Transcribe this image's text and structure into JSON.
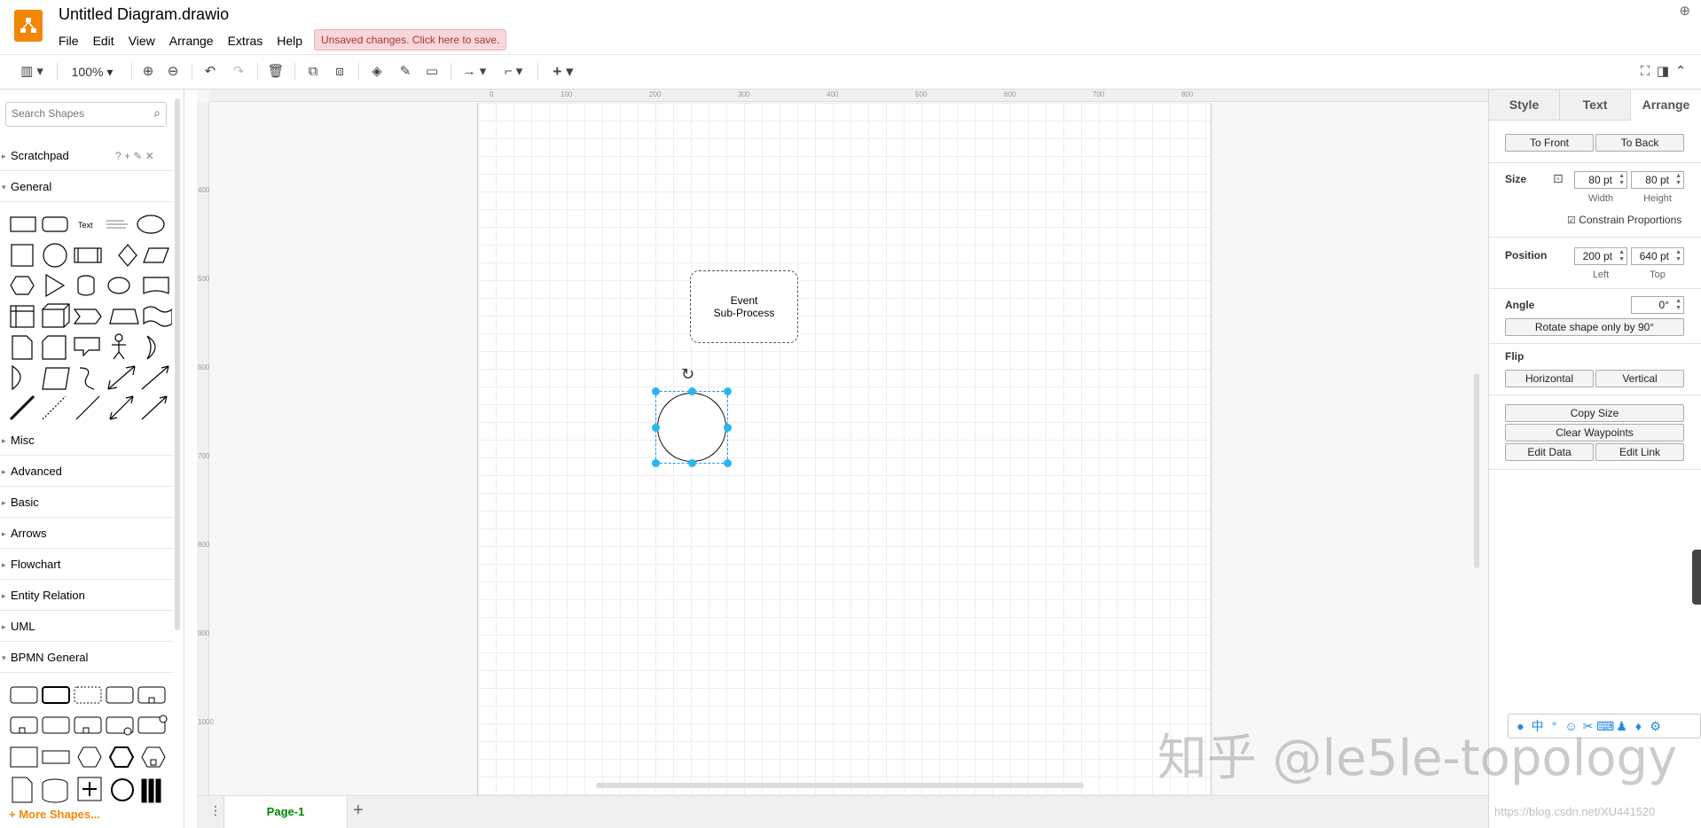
{
  "app": {
    "title": "Untitled Diagram.drawio",
    "menu": [
      "File",
      "Edit",
      "View",
      "Arrange",
      "Extras",
      "Help"
    ],
    "unsaved_notice": "Unsaved changes. Click here to save."
  },
  "toolbar": {
    "zoom": "100%"
  },
  "sidebar": {
    "search_placeholder": "Search Shapes",
    "scratchpad_tools": "? + ✎ ✕",
    "sections": [
      "Scratchpad",
      "General",
      "Misc",
      "Advanced",
      "Basic",
      "Arrows",
      "Flowchart",
      "Entity Relation",
      "UML",
      "BPMN General"
    ],
    "general_text_shape": "Text",
    "more_shapes": "More Shapes..."
  },
  "ruler": {
    "top": [
      "0",
      "100",
      "200",
      "300",
      "400",
      "500",
      "600",
      "700",
      "800"
    ],
    "left": [
      "400",
      "500",
      "600",
      "700",
      "800",
      "900",
      "1000"
    ]
  },
  "diagram": {
    "sub_process_label": "Event\nSub-Process"
  },
  "pages": {
    "tabs": [
      "Page-1"
    ]
  },
  "format_panel": {
    "tabs": [
      "Style",
      "Text",
      "Arrange"
    ],
    "active_tab": "Arrange",
    "to_front": "To Front",
    "to_back": "To Back",
    "size_label": "Size",
    "width_value": "80 pt",
    "height_value": "80 pt",
    "width_label": "Width",
    "height_label": "Height",
    "constrain": "Constrain Proportions",
    "position_label": "Position",
    "left_value": "200 pt",
    "top_value": "640 pt",
    "left_label": "Left",
    "top_label": "Top",
    "angle_label": "Angle",
    "angle_value": "0°",
    "rotate_btn": "Rotate shape only by 90°",
    "flip_label": "Flip",
    "flip_horizontal": "Horizontal",
    "flip_vertical": "Vertical",
    "copy_size": "Copy Size",
    "clear_waypoints": "Clear Waypoints",
    "edit_data": "Edit Data",
    "edit_link": "Edit Link"
  },
  "ime": {
    "lang": "中"
  },
  "watermark": {
    "main": "知乎 @le5le-topology",
    "url": "https://blog.csdn.net/XU441520"
  }
}
